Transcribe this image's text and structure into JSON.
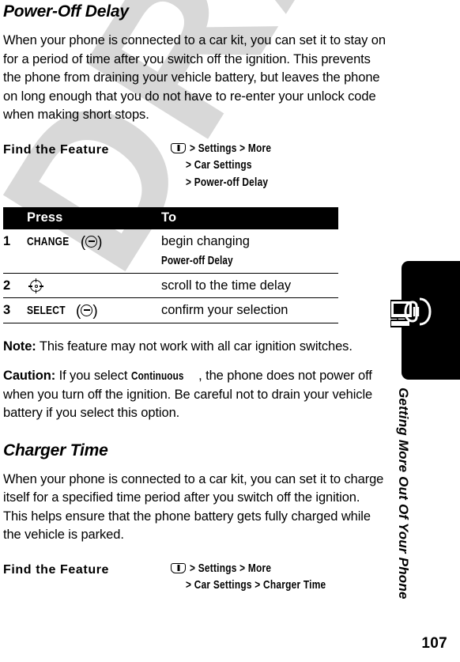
{
  "page": {
    "number": "107",
    "watermark": "DRAFT",
    "chapter_tab_label": "Getting More Out Of Your Phone",
    "tab_icon": "computer-phone-icon",
    "tab_color": "#000000"
  },
  "sections": [
    {
      "title": "Power-Off Delay",
      "body": "When your phone is connected to a car kit, you can set it to stay on for a period of time after you switch off the ignition. This prevents the phone from draining your vehicle battery, but leaves the phone on long enough that you do not have to re-enter your unlock code when making short stops.",
      "find_the_feature": {
        "label": "Find the Feature",
        "menu_icon": "menu-softkey-icon",
        "lines": [
          "> Settings > More",
          "> Car Settings",
          "> Power-off Delay"
        ]
      },
      "steps_table": {
        "headers": {
          "num": "",
          "press": "Press",
          "to": "To"
        },
        "rows": [
          {
            "num": "1",
            "press_label": "CHANGE",
            "press_key": "softkey-minus-icon",
            "to_prefix": "begin changing ",
            "to_bold": "Power-off Delay",
            "to_suffix": ""
          },
          {
            "num": "2",
            "press_label": "",
            "press_key": "four-way-nav-key-icon",
            "to_prefix": "scroll to the time delay",
            "to_bold": "",
            "to_suffix": ""
          },
          {
            "num": "3",
            "press_label": "SELECT",
            "press_key": "softkey-minus-icon",
            "to_prefix": "confirm your selection",
            "to_bold": "",
            "to_suffix": ""
          }
        ]
      },
      "note": {
        "lead": "Note:",
        "text": " This feature may not work with all car ignition switches."
      },
      "caution": {
        "lead": "Caution:",
        "text_before": " If you select ",
        "emphasis": "Continuous",
        "text_after": ", the phone does not power off when you turn off the ignition. Be careful not to drain your vehicle battery if you select this option."
      }
    },
    {
      "title": "Charger Time",
      "body": "When your phone is connected to a car kit, you can set it to charge itself for a specified time period after you switch off the ignition. This helps ensure that the phone battery gets fully charged while the vehicle is parked.",
      "find_the_feature": {
        "label": "Find the Feature",
        "menu_icon": "menu-softkey-icon",
        "lines": [
          "> Settings > More",
          "> Car Settings > Charger Time"
        ]
      }
    }
  ]
}
